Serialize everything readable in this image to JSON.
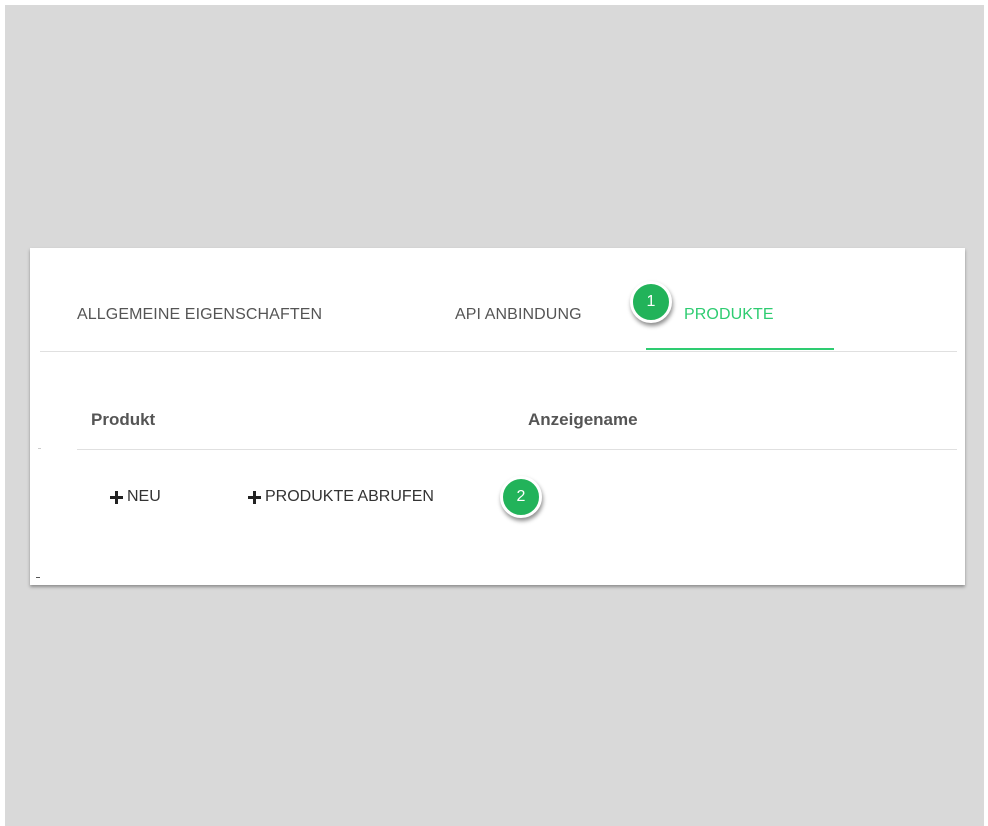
{
  "tabs": [
    {
      "label": "ALLGEMEINE EIGENSCHAFTEN",
      "active": false
    },
    {
      "label": "API ANBINDUNG",
      "active": false
    },
    {
      "label": "PRODUKTE",
      "active": true
    }
  ],
  "table": {
    "columns": [
      "Produkt",
      "Anzeigename"
    ]
  },
  "actions": {
    "new_label": "NEU",
    "fetch_label": "PRODUKTE ABRUFEN"
  },
  "callouts": [
    "1",
    "2"
  ],
  "colors": {
    "accent": "#2ecc71",
    "callout": "#22b35a",
    "backdrop": "#d9d9d9"
  },
  "icons": [
    "plus-icon",
    "plus-icon"
  ]
}
